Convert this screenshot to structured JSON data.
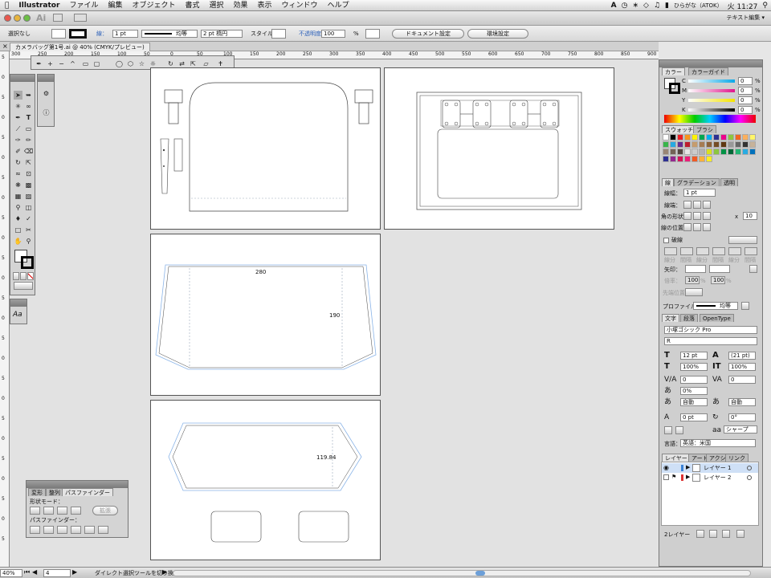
{
  "menubar": {
    "app": "Illustrator",
    "items": [
      "ファイル",
      "編集",
      "オブジェクト",
      "書式",
      "選択",
      "効果",
      "表示",
      "ウィンドウ",
      "ヘルプ"
    ],
    "input_mode": "ひらがな（ATOK）",
    "clock": "火 11:27"
  },
  "appbar": {
    "workspace": "テキスト編集 ▾"
  },
  "control": {
    "selection": "選択なし",
    "stroke_label": "線：",
    "stroke_weight": "1 pt",
    "profile": "均等",
    "brush": "2 pt 楕円",
    "style_label": "スタイル：",
    "opacity_label": "不透明度：",
    "opacity": "100",
    "opacity_unit": "%",
    "doc_setup": "ドキュメント設定",
    "prefs": "環境設定"
  },
  "document": {
    "tab": "カメラバッグ第1号.ai @ 40% (CMYK/プレビュー)"
  },
  "ruler": {
    "h": [
      "300",
      "250",
      "200",
      "150",
      "100",
      "50",
      "0",
      "50",
      "100",
      "150",
      "200",
      "250",
      "300",
      "350",
      "400",
      "450",
      "500",
      "550",
      "600",
      "650",
      "700",
      "750",
      "800",
      "850",
      "900"
    ],
    "v": [
      "5",
      "0",
      "5",
      "0",
      "5",
      "0",
      "5",
      "0",
      "5",
      "0",
      "5",
      "0",
      "5",
      "0",
      "5",
      "0",
      "5",
      "0",
      "5",
      "0",
      "5",
      "0",
      "5",
      "0",
      "5"
    ]
  },
  "artwork": {
    "dim_top": "280",
    "dim_side": "190",
    "dim_bottom": "119.84"
  },
  "panels": {
    "color": {
      "tabs": [
        "カラー",
        "カラーガイド"
      ],
      "channels": [
        "C",
        "M",
        "Y",
        "K"
      ],
      "values": [
        "0",
        "0",
        "0",
        "0"
      ],
      "unit": "%"
    },
    "swatch": {
      "tabs": [
        "スウォッチ",
        "ブラシ"
      ]
    },
    "stroke": {
      "tabs": [
        "線",
        "グラデーション",
        "透明"
      ],
      "weight_label": "線幅：",
      "weight": "1 pt",
      "cap_label": "線端：",
      "join_label": "角の形状：",
      "limit": "10",
      "limit_x": "x",
      "align_label": "線の位置：",
      "dashed": "破線",
      "dash_labels": [
        "線分",
        "間隔",
        "線分",
        "間隔",
        "線分",
        "間隔"
      ],
      "arrow_label": "矢印：",
      "scale_label": "倍率：",
      "scale1": "100",
      "scale2": "100",
      "scale_unit": "%",
      "arrow_pos_label": "先端位置：",
      "profile_label": "プロファイル：",
      "profile": "均等"
    },
    "type": {
      "tabs": [
        "文字",
        "段落",
        "OpenType"
      ],
      "font": "小塚ゴシック Pro",
      "style": "R",
      "size": "12 pt",
      "leading": "(21 pt)",
      "vscale": "100%",
      "hscale": "100%",
      "kern": "0",
      "track": "0",
      "tsume": "0%",
      "aki1": "自動",
      "aki2": "自動",
      "baseline": "0 pt",
      "rotate": "0°",
      "aa": "シャープ",
      "lang_label": "言語：",
      "lang": "英語：米国"
    },
    "layers": {
      "tabs": [
        "レイヤー",
        "アート",
        "アクシ",
        "リンク"
      ],
      "items": [
        {
          "name": "レイヤー 1"
        },
        {
          "name": "レイヤー 2"
        }
      ],
      "count": "2レイヤー"
    },
    "pathfinder": {
      "tabs": [
        "変形",
        "整列",
        "パスファインダー"
      ],
      "shape_mode": "形状モード：",
      "expand": "拡張",
      "pathfinder_label": "パスファインダー："
    },
    "char_style": {
      "icon": "Aa"
    }
  },
  "status": {
    "zoom": "40%",
    "page": "4",
    "tool": "ダイレクト選択ツールを切り換え"
  },
  "colors": {
    "accent": "#3b82d6",
    "guide": "#8ab4e8",
    "dashed": "#9aa8b8",
    "panel": "#d4d4d4"
  }
}
